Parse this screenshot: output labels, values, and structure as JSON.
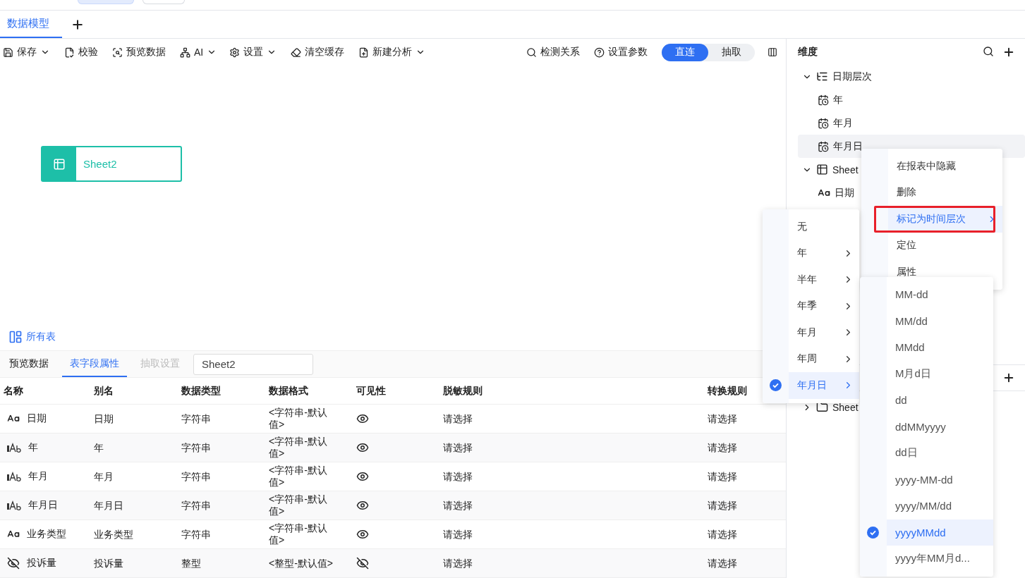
{
  "top_tabs": [
    {
      "selected": true
    },
    {
      "selected": false
    }
  ],
  "model_tabs": [
    {
      "label": "数据模型",
      "selected": true
    }
  ],
  "toolbar": {
    "left": [
      {
        "label": "保存",
        "dropdown": true
      },
      {
        "label": "校验",
        "dropdown": false
      },
      {
        "label": "预览数据",
        "dropdown": false
      },
      {
        "label": "AI",
        "dropdown": true
      },
      {
        "label": "设置",
        "dropdown": true
      },
      {
        "label": "清空缓存",
        "dropdown": false
      },
      {
        "label": "新建分析",
        "dropdown": true
      }
    ],
    "right": [
      {
        "label": "检测关系"
      },
      {
        "label": "设置参数"
      }
    ],
    "mode": [
      {
        "label": "直连",
        "selected": true
      },
      {
        "label": "抽取",
        "selected": false
      }
    ]
  },
  "canvas": {
    "nodes": [
      {
        "label": "Sheet2"
      }
    ],
    "all_tables": "所有表"
  },
  "bottom_panel": {
    "tabs": [
      {
        "label": "预览数据",
        "selected": false,
        "disabled": false
      },
      {
        "label": "表字段属性",
        "selected": true,
        "disabled": false
      },
      {
        "label": "抽取设置",
        "selected": false,
        "disabled": true
      }
    ],
    "table_select": "Sheet2",
    "columns": [
      "名称",
      "别名",
      "数据类型",
      "数据格式",
      "可见性",
      "脱敏规则",
      "转换规则"
    ],
    "rows": [
      {
        "kind": "text",
        "name": "日期",
        "alias": "日期",
        "type": "字符串",
        "format": "<字符串-默认值>",
        "visible": true,
        "masking": "请选择",
        "conversion": "请选择"
      },
      {
        "kind": "level-text",
        "name": "年",
        "alias": "年",
        "type": "字符串",
        "format": "<字符串-默认值>",
        "visible": true,
        "masking": "请选择",
        "conversion": "请选择"
      },
      {
        "kind": "level-text",
        "name": "年月",
        "alias": "年月",
        "type": "字符串",
        "format": "<字符串-默认值>",
        "visible": true,
        "masking": "请选择",
        "conversion": "请选择"
      },
      {
        "kind": "level-text",
        "name": "年月日",
        "alias": "年月日",
        "type": "字符串",
        "format": "<字符串-默认值>",
        "visible": true,
        "masking": "请选择",
        "conversion": "请选择"
      },
      {
        "kind": "text",
        "name": "业务类型",
        "alias": "业务类型",
        "type": "字符串",
        "format": "<字符串-默认值>",
        "visible": true,
        "masking": "请选择",
        "conversion": "请选择"
      },
      {
        "kind": "hidden",
        "name": "投诉量",
        "alias": "投诉量",
        "type": "整型",
        "format": "<整型-默认值>",
        "visible": false,
        "masking": "请选择",
        "conversion": "请选择"
      }
    ]
  },
  "dimension_panel": {
    "title": "维度",
    "tree": [
      {
        "label": "日期层次",
        "kind": "hierarchy",
        "expanded": true,
        "selected": false,
        "children": [
          {
            "label": "年",
            "kind": "date-level",
            "selected": false
          },
          {
            "label": "年月",
            "kind": "date-level",
            "selected": false
          },
          {
            "label": "年月日",
            "kind": "date-level",
            "selected": true
          }
        ]
      },
      {
        "label": "Sheet",
        "kind": "table",
        "expanded": true,
        "selected": false,
        "children": [
          {
            "label": "日期",
            "kind": "text-field",
            "selected": false
          }
        ]
      }
    ],
    "tree2": [
      {
        "label": "Sheet",
        "kind": "folder",
        "expanded": false,
        "selected": false
      }
    ]
  },
  "context_menu": {
    "items": [
      {
        "label": "在报表中隐藏",
        "highlighted": false,
        "submenu": false,
        "framed": false
      },
      {
        "label": "删除",
        "highlighted": false,
        "submenu": false,
        "framed": false
      },
      {
        "label": "标记为时间层次",
        "highlighted": true,
        "submenu": true,
        "framed": true
      },
      {
        "label": "定位",
        "highlighted": false,
        "submenu": false,
        "framed": false
      },
      {
        "label": "属性",
        "highlighted": false,
        "submenu": false,
        "framed": false
      }
    ]
  },
  "level_menu": {
    "items": [
      {
        "label": "无",
        "selected": false,
        "submenu": false
      },
      {
        "label": "年",
        "selected": false,
        "submenu": true
      },
      {
        "label": "半年",
        "selected": false,
        "submenu": true
      },
      {
        "label": "年季",
        "selected": false,
        "submenu": true
      },
      {
        "label": "年月",
        "selected": false,
        "submenu": true
      },
      {
        "label": "年周",
        "selected": false,
        "submenu": true
      },
      {
        "label": "年月日",
        "selected": true,
        "submenu": true
      }
    ]
  },
  "format_menu": {
    "items": [
      {
        "label": "MM-dd",
        "selected": false
      },
      {
        "label": "MM/dd",
        "selected": false
      },
      {
        "label": "MMdd",
        "selected": false
      },
      {
        "label": "M月d日",
        "selected": false
      },
      {
        "label": "dd",
        "selected": false
      },
      {
        "label": "ddMMyyyy",
        "selected": false
      },
      {
        "label": "dd日",
        "selected": false
      },
      {
        "label": "yyyy-MM-dd",
        "selected": false
      },
      {
        "label": "yyyy/MM/dd",
        "selected": false
      },
      {
        "label": "yyyyMMdd",
        "selected": true
      },
      {
        "label": "yyyy年MM月d...",
        "selected": false
      }
    ]
  }
}
